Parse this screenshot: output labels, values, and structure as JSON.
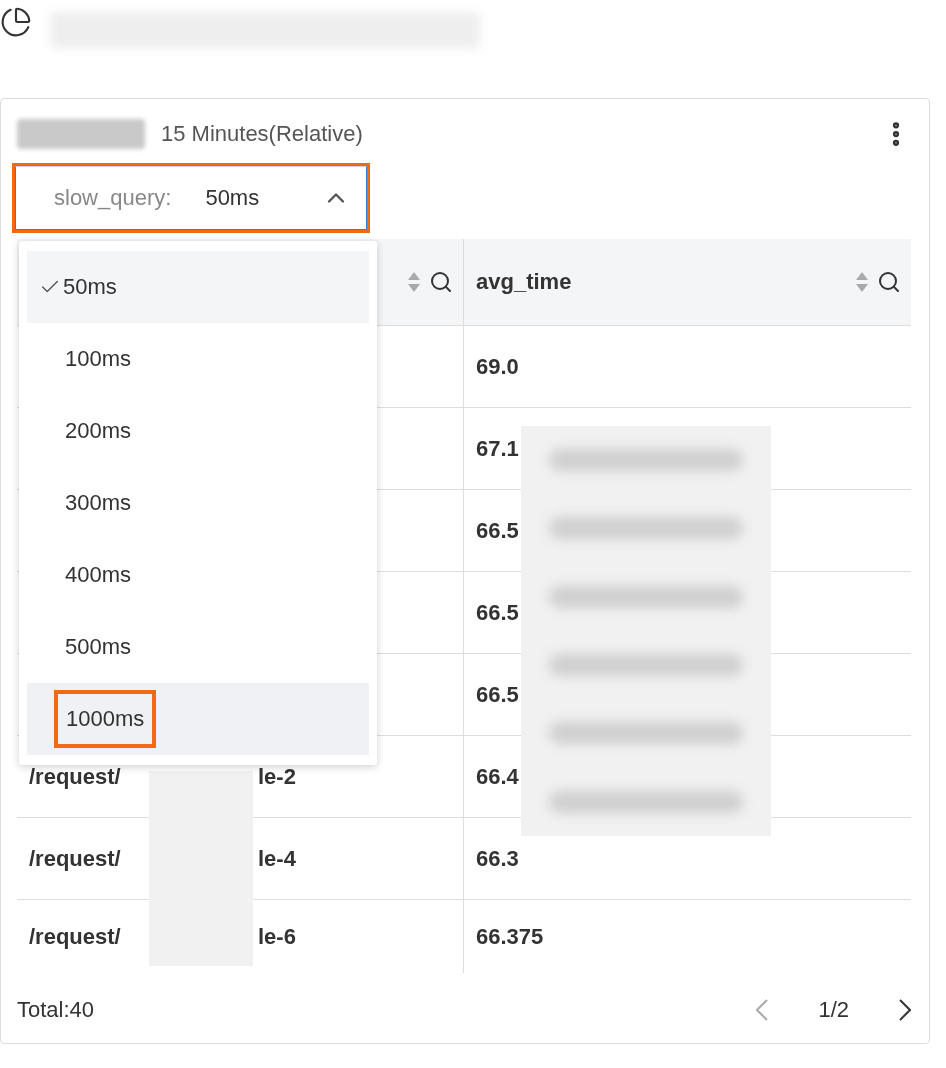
{
  "panel": {
    "time_range": "15 Minutes(Relative)",
    "filter": {
      "label": "slow_query:",
      "value": "50ms",
      "open": true,
      "highlighted": true
    },
    "options": [
      {
        "label": "50ms",
        "selected": true,
        "hovered": false,
        "highlighted": false
      },
      {
        "label": "100ms",
        "selected": false,
        "hovered": false,
        "highlighted": false
      },
      {
        "label": "200ms",
        "selected": false,
        "hovered": false,
        "highlighted": false
      },
      {
        "label": "300ms",
        "selected": false,
        "hovered": false,
        "highlighted": false
      },
      {
        "label": "400ms",
        "selected": false,
        "hovered": false,
        "highlighted": false
      },
      {
        "label": "500ms",
        "selected": false,
        "hovered": false,
        "highlighted": false
      },
      {
        "label": "1000ms",
        "selected": false,
        "hovered": true,
        "highlighted": true
      }
    ],
    "table": {
      "column_2": "avg_time",
      "rows": [
        {
          "avg_time": "69.0"
        },
        {
          "avg_time": "67.1"
        },
        {
          "avg_time": "66.5"
        },
        {
          "avg_time": "66.5"
        },
        {
          "avg_time": "66.5"
        },
        {
          "path_start": "/request/",
          "path_end": "le-2",
          "avg_time": "66.4"
        },
        {
          "path_start": "/request/",
          "path_end": "le-4",
          "avg_time": "66.3"
        },
        {
          "path_start": "/request/",
          "path_end": "le-6",
          "avg_time": "66.375"
        }
      ]
    },
    "footer": {
      "total": "Total:40",
      "page": "1/2",
      "prev_enabled": false,
      "next_enabled": true
    }
  }
}
